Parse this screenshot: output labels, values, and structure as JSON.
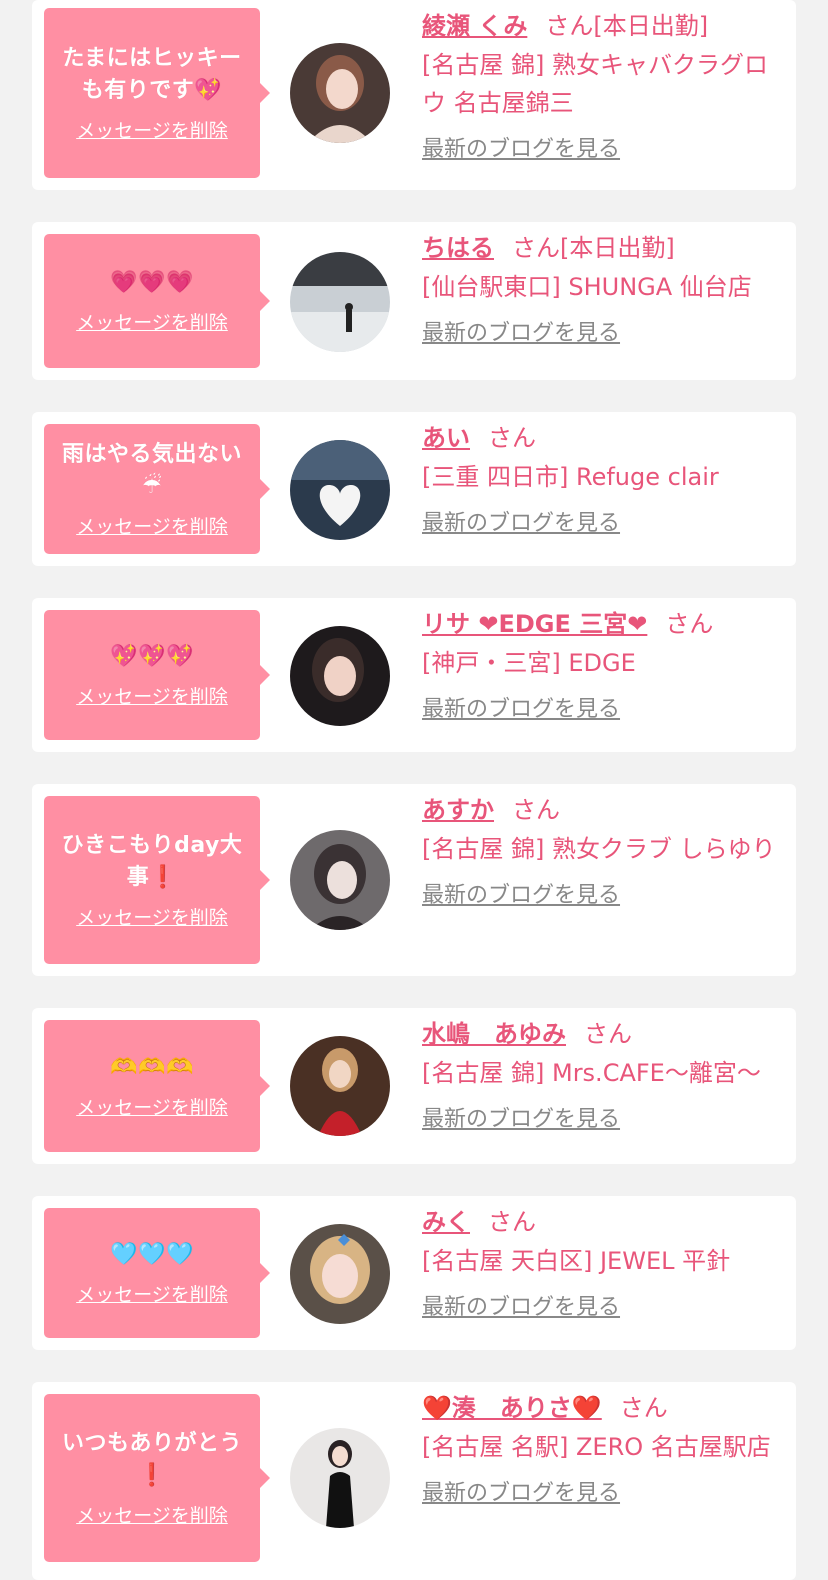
{
  "colors": {
    "page_bg": "#f2f2f2",
    "card_bg": "#ffffff",
    "bubble_bg": "#ff8fa3",
    "accent_pink": "#e8557a",
    "link_gray": "#888888"
  },
  "common": {
    "delete_label": "メッセージを削除",
    "blog_label": "最新のブログを見る",
    "honorific": "さん"
  },
  "entries": [
    {
      "message": "たまにはヒッキーも有りです💖",
      "name": "綾瀬 くみ",
      "status": "[本日出勤]",
      "shop": "[名古屋 錦] 熟女キャバクラグロウ 名古屋錦三",
      "avatar_icon": "woman-portrait-avatar"
    },
    {
      "message": "💗💗💗",
      "name": "ちはる",
      "status": "[本日出勤]",
      "shop": "[仙台駅東口] SHUNGA 仙台店",
      "avatar_icon": "snow-scene-avatar"
    },
    {
      "message": "雨はやる気出ない☔",
      "name": "あい",
      "status": "",
      "shop": "[三重 四日市] Refuge clair",
      "avatar_icon": "heart-avatar"
    },
    {
      "message": "💖💖💖",
      "name": "リサ ❤EDGE 三宮❤",
      "status": "",
      "shop": "[神戸・三宮] EDGE",
      "avatar_icon": "woman-portrait-avatar"
    },
    {
      "message": "ひきこもりday大事❗",
      "name": "あすか",
      "status": "",
      "shop": "[名古屋 錦] 熟女クラブ しらゆり",
      "avatar_icon": "woman-portrait-avatar"
    },
    {
      "message": "🫶🫶🫶",
      "name": "水嶋　あゆみ",
      "status": "",
      "shop": "[名古屋 錦] Mrs.CAFE〜離宮〜",
      "avatar_icon": "woman-red-dress-avatar"
    },
    {
      "message": "🩵🩵🩵",
      "name": "みく",
      "status": "",
      "shop": "[名古屋 天白区] JEWEL 平針",
      "avatar_icon": "woman-portrait-avatar"
    },
    {
      "message": "いつもありがとう❗",
      "name": "❤️湊　ありさ❤️",
      "status": "",
      "shop": "[名古屋 名駅] ZERO 名古屋駅店",
      "avatar_icon": "woman-black-dress-avatar"
    }
  ]
}
